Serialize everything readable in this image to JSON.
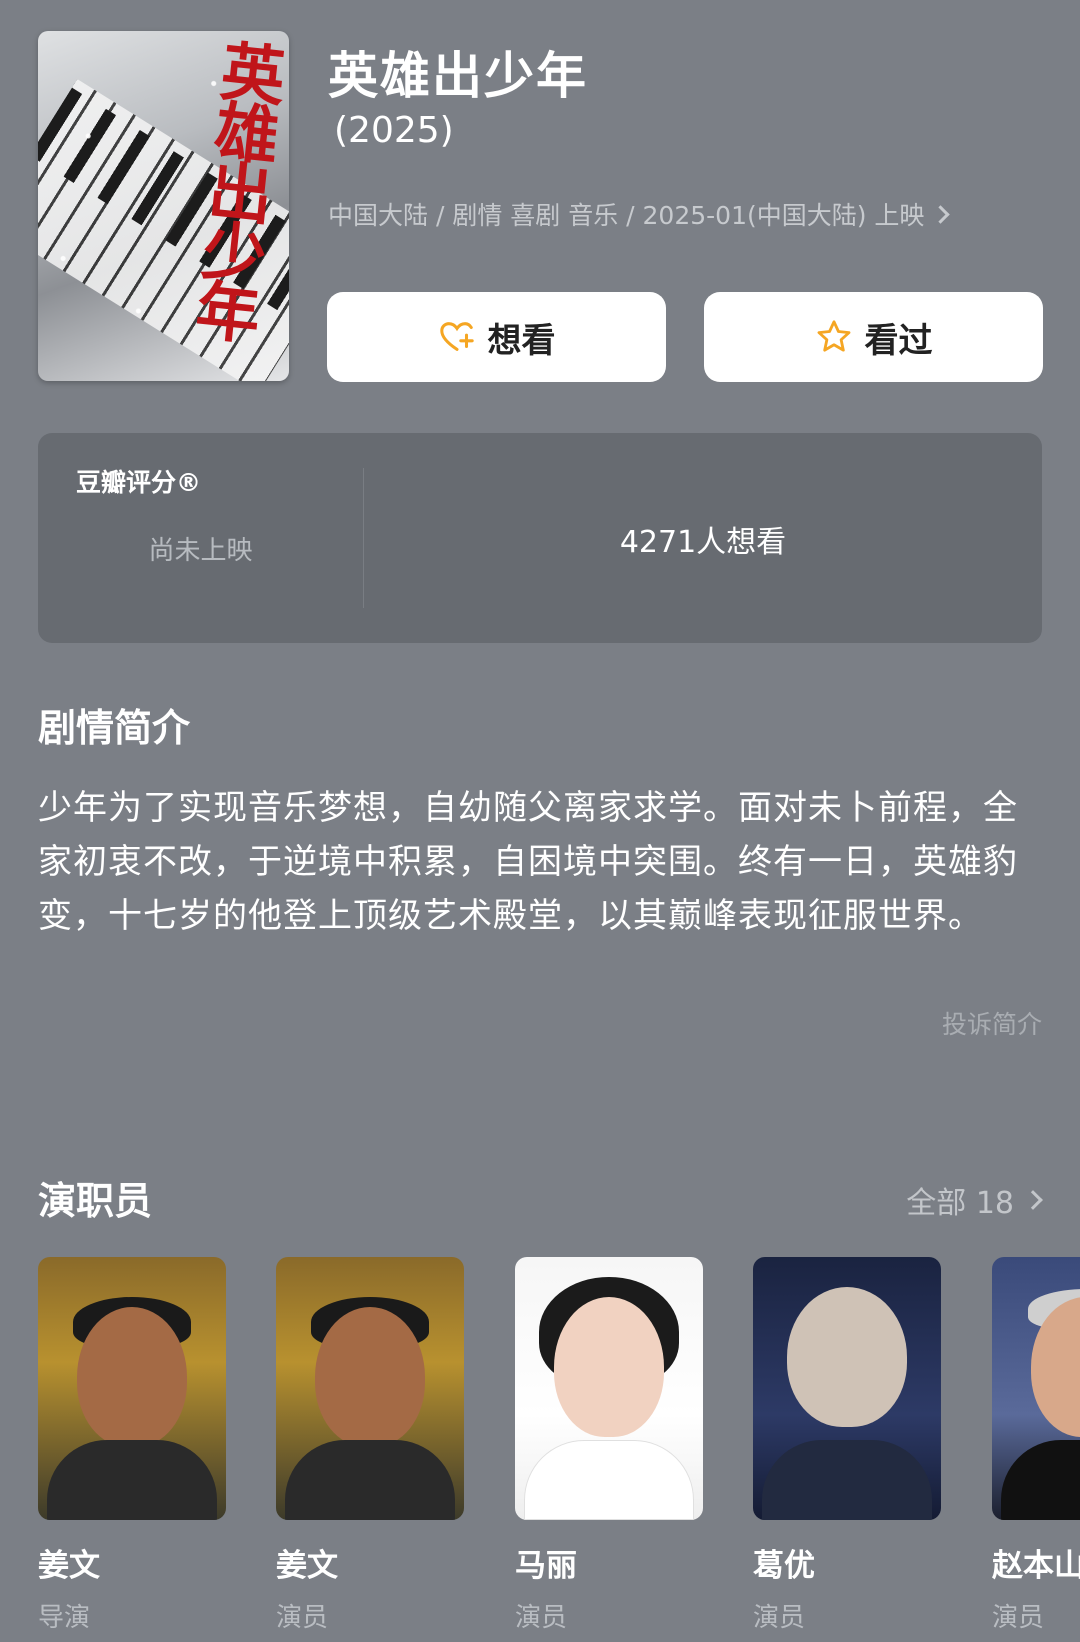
{
  "movie": {
    "title": "英雄出少年",
    "year": "(2025)",
    "meta": "中国大陆 / 剧情 喜剧 音乐 / 2025-01(中国大陆) 上映",
    "poster_calligraphy": "英雄出少年"
  },
  "actions": {
    "want_label": "想看",
    "seen_label": "看过"
  },
  "rating": {
    "label": "豆瓣评分®",
    "status": "尚未上映",
    "wish_count": "4271人想看"
  },
  "synopsis": {
    "heading": "剧情简介",
    "text": "少年为了实现音乐梦想，自幼随父离家求学。面对未卜前程，全家初衷不改，于逆境中积累，自困境中突围。终有一日，英雄豹变，十七岁的他登上顶级艺术殿堂，以其巅峰表现征服世界。",
    "report_label": "投诉简介"
  },
  "cast": {
    "heading": "演职员",
    "all_label": "全部 18",
    "members": [
      {
        "name": "姜文",
        "role": "导演"
      },
      {
        "name": "姜文",
        "role": "演员"
      },
      {
        "name": "马丽",
        "role": "演员"
      },
      {
        "name": "葛优",
        "role": "演员"
      },
      {
        "name": "赵本山",
        "role": "演员"
      }
    ]
  },
  "colors": {
    "background": "#7b7f86",
    "card": "#676b71",
    "accent_icon": "#f5a623"
  },
  "icons": {
    "want": "heart-plus-icon",
    "seen": "star-outline-icon",
    "meta_arrow": "chevron-right-icon",
    "all_arrow": "chevron-right-icon"
  }
}
